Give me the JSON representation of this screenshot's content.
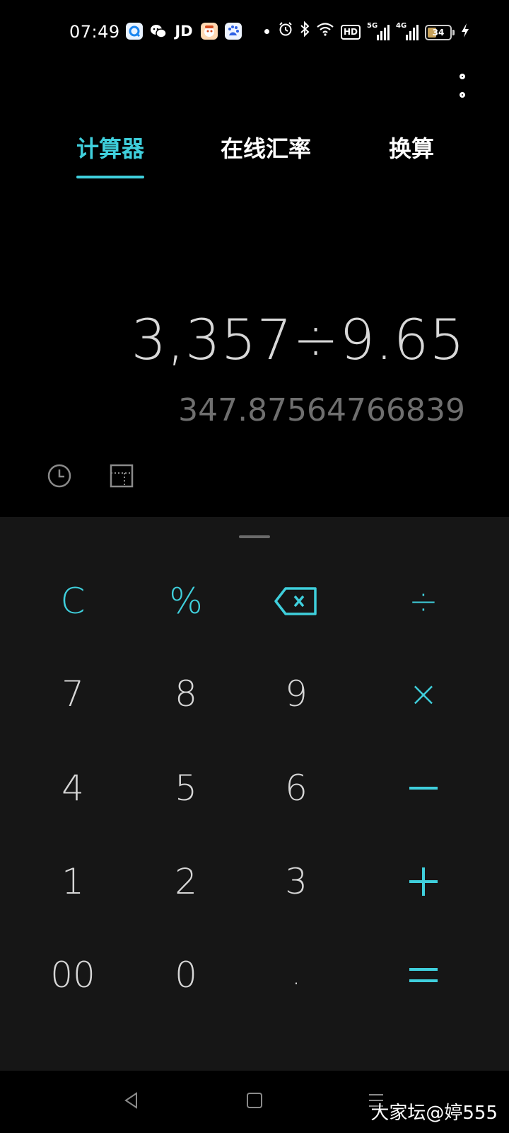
{
  "status_bar": {
    "time": "07:49",
    "jd_label": "JD",
    "hd_label": "HD",
    "net_5g": "5G",
    "net_4g": "4G",
    "battery_level": "34"
  },
  "tabs": [
    {
      "label": "计算器",
      "active": true
    },
    {
      "label": "在线汇率",
      "active": false
    },
    {
      "label": "换算",
      "active": false
    }
  ],
  "display": {
    "expression": "3,357÷9.65",
    "result": "347.87564766839"
  },
  "keypad": {
    "clear": "C",
    "percent": "%",
    "divide": "÷",
    "seven": "7",
    "eight": "8",
    "nine": "9",
    "multiply": "×",
    "four": "4",
    "five": "5",
    "six": "6",
    "one": "1",
    "two": "2",
    "three": "3",
    "double_zero": "00",
    "zero": "0",
    "dot": "."
  },
  "watermark": "大家坛@婷555",
  "colors": {
    "accent": "#3fcfdc",
    "background": "#000000",
    "keypad_bg": "#161616",
    "digit": "#d6d6d6",
    "result": "#6f6f6f"
  }
}
